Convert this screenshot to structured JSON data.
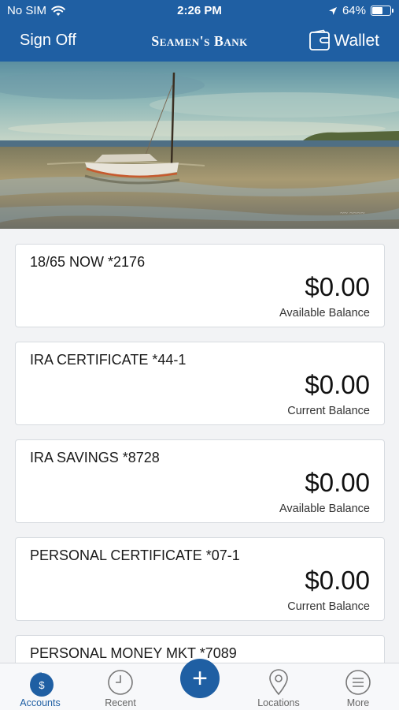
{
  "status_bar": {
    "carrier": "No SIM",
    "time": "2:26 PM",
    "battery": "64%",
    "battery_level": 0.64,
    "wifi_icon": "wifi-icon",
    "location_icon": "location-arrow-icon"
  },
  "header": {
    "sign_off_label": "Sign Off",
    "logo_text": "Seamen's Bank",
    "wallet_label": "Wallet",
    "wallet_icon": "wallet-icon"
  },
  "accounts": [
    {
      "name": "18/65 NOW *2176",
      "amount": "$0.00",
      "balance_label": "Available Balance"
    },
    {
      "name": "IRA CERTIFICATE *44-1",
      "amount": "$0.00",
      "balance_label": "Current Balance"
    },
    {
      "name": "IRA SAVINGS *8728",
      "amount": "$0.00",
      "balance_label": "Available Balance"
    },
    {
      "name": "PERSONAL CERTIFICATE *07-1",
      "amount": "$0.00",
      "balance_label": "Current Balance"
    },
    {
      "name": "PERSONAL MONEY MKT *7089",
      "amount": "",
      "balance_label": ""
    }
  ],
  "tab_bar": {
    "tabs": [
      {
        "label": "Accounts",
        "icon": "accounts-dollar-icon",
        "active": true
      },
      {
        "label": "Recent",
        "icon": "clock-icon",
        "active": false
      },
      {
        "label": "Locations",
        "icon": "map-pin-icon",
        "active": false
      },
      {
        "label": "More",
        "icon": "menu-icon",
        "active": false
      }
    ],
    "fab_label": "+",
    "fab_icon": "plus-icon"
  },
  "colors": {
    "brand": "#1f5fa3",
    "background": "#f2f3f5",
    "card": "#ffffff"
  }
}
